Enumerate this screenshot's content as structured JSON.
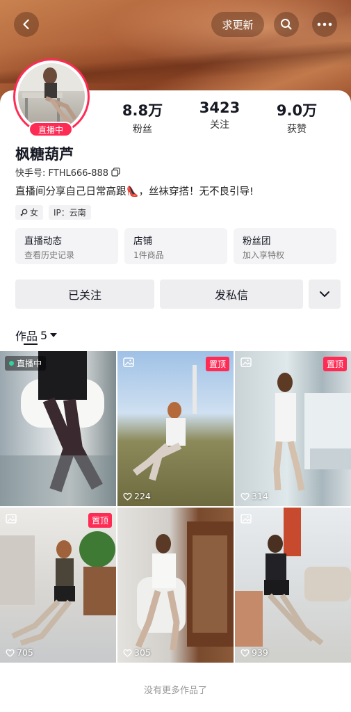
{
  "header": {
    "update_label": "求更新"
  },
  "profile": {
    "live_badge": "直播中",
    "name": "枫糖葫芦",
    "uid": "快手号: FTHL666-888",
    "bio": "直播间分享自己日常高跟👠，丝袜穿搭！无不良引导!",
    "gender_tag": "女",
    "ip_tag": "IP：云南"
  },
  "stats": [
    {
      "value": "8.8万",
      "label": "粉丝"
    },
    {
      "value": "3423",
      "label": "关注"
    },
    {
      "value": "9.0万",
      "label": "获赞"
    }
  ],
  "cards": [
    {
      "title": "直播动态",
      "sub": "查看历史记录"
    },
    {
      "title": "店铺",
      "sub": "1件商品"
    },
    {
      "title": "粉丝团",
      "sub": "加入享特权"
    }
  ],
  "actions": {
    "follow_label": "已关注",
    "message_label": "发私信"
  },
  "works_tab": {
    "label": "作品",
    "count": "5"
  },
  "grid": [
    {
      "live_label": "直播中",
      "pin": "",
      "likes": ""
    },
    {
      "live_label": "",
      "pin": "置顶",
      "likes": "224"
    },
    {
      "live_label": "",
      "pin": "置顶",
      "likes": "314"
    },
    {
      "live_label": "",
      "pin": "置顶",
      "likes": "705"
    },
    {
      "live_label": "",
      "pin": "",
      "likes": "305"
    },
    {
      "live_label": "",
      "pin": "",
      "likes": "939"
    }
  ],
  "footer_text": "没有更多作品了",
  "colors": {
    "accent": "#fe2c55",
    "live_dot": "#2fd39b"
  }
}
